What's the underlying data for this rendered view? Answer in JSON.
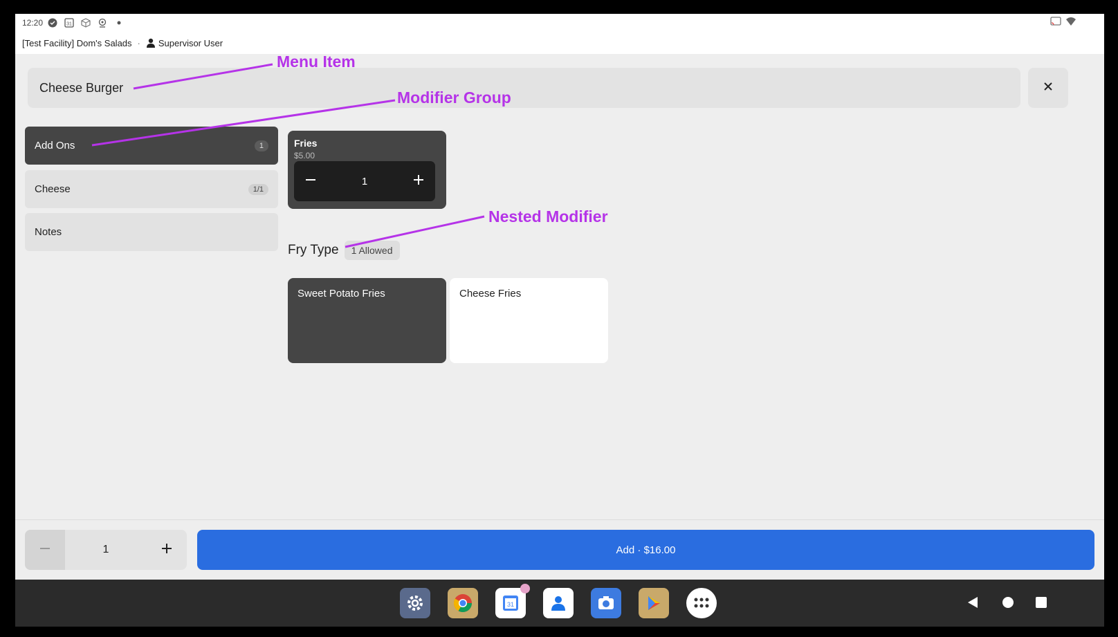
{
  "status_bar": {
    "time": "12:20",
    "icons": [
      "check-circle-icon",
      "calendar-icon",
      "package-icon",
      "location-icon",
      "dot-icon"
    ],
    "right_icons": [
      "cast-icon",
      "wifi-icon"
    ]
  },
  "facility_bar": {
    "facility": "[Test Facility] Dom's Salads",
    "separator": "·",
    "user": "Supervisor User"
  },
  "header": {
    "menu_item": "Cheese Burger",
    "close_icon": "close-icon"
  },
  "modifier_groups": [
    {
      "label": "Add Ons",
      "badge": "1",
      "active": true
    },
    {
      "label": "Cheese",
      "badge": "1/1",
      "active": false
    },
    {
      "label": "Notes",
      "badge": "",
      "active": false
    }
  ],
  "selected_modifier": {
    "name": "Fries",
    "price": "$5.00",
    "quantity": "1"
  },
  "nested_group": {
    "title": "Fry Type",
    "allowed": "1 Allowed",
    "options": [
      {
        "label": "Sweet Potato Fries",
        "selected": true
      },
      {
        "label": "Cheese Fries",
        "selected": false
      }
    ]
  },
  "footer": {
    "quantity": "1",
    "add_label": "Add · $16.00"
  },
  "annotations": {
    "menu_item": "Menu Item",
    "modifier_group": "Modifier Group",
    "nested_modifier": "Nested Modifier"
  },
  "taskbar": {
    "apps": [
      "settings-icon",
      "chrome-icon",
      "calendar-icon",
      "contacts-icon",
      "camera-icon",
      "play-store-icon",
      "app-drawer-icon"
    ],
    "nav": [
      "back-icon",
      "home-icon",
      "recents-icon"
    ]
  },
  "colors": {
    "accent": "#2a6de0",
    "annotation": "#b533e8",
    "selected_bg": "#454545"
  }
}
